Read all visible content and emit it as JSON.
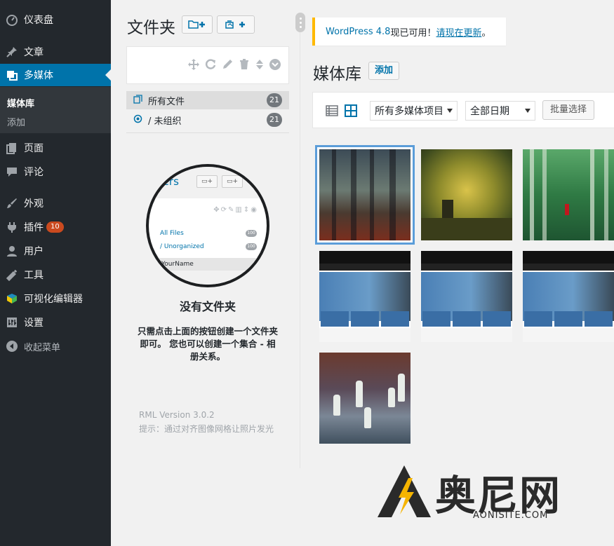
{
  "sidebar": {
    "items": [
      {
        "label": "仪表盘",
        "icon": "dashboard-icon"
      },
      {
        "label": "文章",
        "icon": "pin-icon"
      },
      {
        "label": "多媒体",
        "icon": "media-icon"
      },
      {
        "label": "页面",
        "icon": "pages-icon"
      },
      {
        "label": "评论",
        "icon": "comment-icon"
      },
      {
        "label": "外观",
        "icon": "brush-icon"
      },
      {
        "label": "插件",
        "icon": "plugin-icon",
        "badge": "10"
      },
      {
        "label": "用户",
        "icon": "user-icon"
      },
      {
        "label": "工具",
        "icon": "wrench-icon"
      },
      {
        "label": "可视化编辑器",
        "icon": "editor-icon"
      },
      {
        "label": "设置",
        "icon": "settings-icon"
      },
      {
        "label": "收起菜单",
        "icon": "collapse-icon"
      }
    ],
    "submenu": [
      {
        "label": "媒体库"
      },
      {
        "label": "添加"
      }
    ]
  },
  "folders": {
    "title": "文件夹",
    "tree": [
      {
        "label": "所有文件",
        "count": "21"
      },
      {
        "label": "/ 未组织",
        "count": "21"
      }
    ],
    "preview": {
      "title": "lders",
      "items": [
        {
          "label": "All Files",
          "count": "100"
        },
        {
          "label": "/ Unorganized",
          "count": "100"
        }
      ],
      "footer": "YourName"
    },
    "empty_title": "没有文件夹",
    "empty_desc": "只需点击上面的按钮创建一个文件夹即可。 您也可以创建一个集合 - 相册关系。",
    "version": "RML Version 3.0.2",
    "tip": "提示：通过对齐图像网格让照片发光"
  },
  "notice": {
    "link_version": "WordPress 4.8",
    "text_middle": "现已可用！",
    "link_update": "请现在更新",
    "text_end": "。"
  },
  "media": {
    "title": "媒体库",
    "add_label": "添加",
    "filter_type": "所有多媒体项目",
    "filter_date": "全部日期",
    "bulk_label": "批量选择"
  },
  "watermark": {
    "text": "奥尼网",
    "sub": "AONISITE.COM"
  },
  "colors": {
    "sidebar_bg": "#23282d",
    "accent": "#0073aa",
    "notice_border": "#ffb900",
    "badge": "#ca4a1f"
  }
}
